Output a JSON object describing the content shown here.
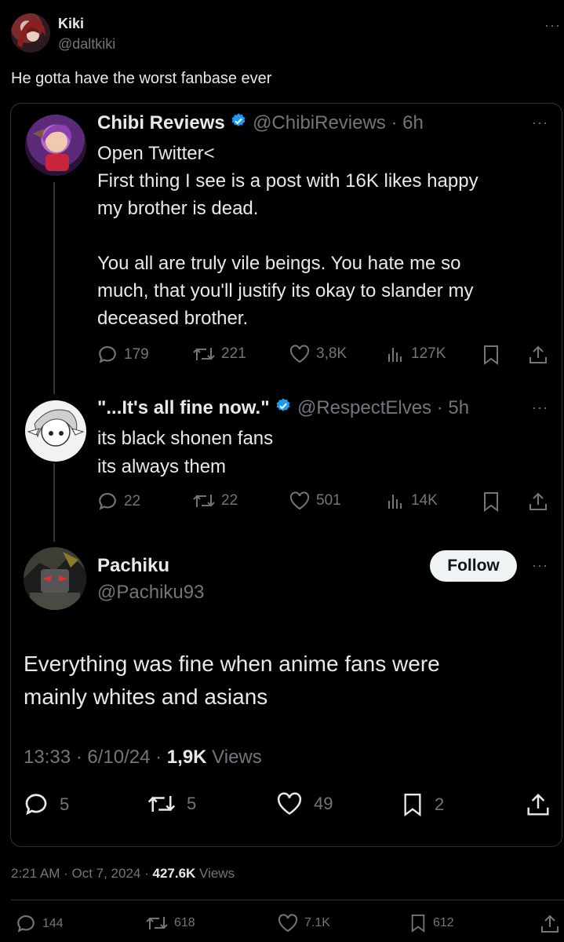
{
  "outer": {
    "display_name": "Kiki",
    "handle": "@daltkiki",
    "more": "···",
    "text": "He gotta have the worst fanbase ever",
    "timestamp": "2:21 AM · Oct 7, 2024 · ",
    "views_count": "427.6K",
    "views_label": " Views",
    "stats": {
      "replies": "144",
      "retweets": "618",
      "likes": "7.1K",
      "bookmarks": "612"
    }
  },
  "thread": [
    {
      "display_name": "Chibi Reviews",
      "handle_time": "@ChibiReviews · 6h",
      "lines": [
        "Open Twitter<",
        "First thing I see is a post with 16K likes happy",
        "my brother is dead.",
        "",
        "You all are truly vile beings. You hate me so",
        "much, that you'll justify its okay to slander my",
        "deceased brother."
      ],
      "stats": {
        "replies": "179",
        "retweets": "221",
        "likes": "3,8K",
        "views": "127K"
      }
    },
    {
      "display_name": "\"...It's all fine now.\"",
      "handle_time": "@RespectElves · 5h",
      "lines": [
        "its black shonen fans",
        "its always them"
      ],
      "stats": {
        "replies": "22",
        "retweets": "22",
        "likes": "501",
        "views": "14K"
      }
    }
  ],
  "main_tweet": {
    "display_name": "Pachiku",
    "handle": "@Pachiku93",
    "follow_label": "Follow",
    "lines": [
      "Everything was fine when anime fans were",
      "mainly whites and asians"
    ],
    "meta_time": "13:33 · 6/10/24 · ",
    "meta_views_count": "1,9K",
    "meta_views_label": " Views",
    "stats": {
      "replies": "5",
      "retweets": "5",
      "likes": "49",
      "bookmarks": "2"
    }
  },
  "colors": {
    "background": "#000000",
    "text": "#e7e9ea",
    "muted": "#71767b",
    "verified": "#1d9bf0",
    "border": "#2f3336"
  },
  "icons": [
    "reply-icon",
    "retweet-icon",
    "like-icon",
    "views-icon",
    "bookmark-icon",
    "share-icon",
    "more-icon",
    "verified-badge-icon"
  ]
}
